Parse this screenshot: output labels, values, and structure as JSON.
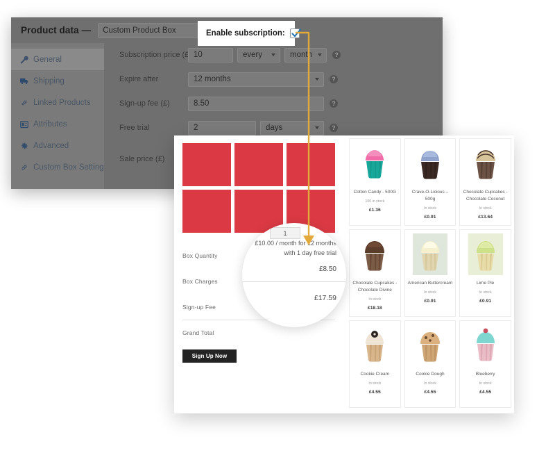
{
  "admin": {
    "title": "Product data —",
    "product_type": "Custom Product Box",
    "tabs": [
      {
        "label": "General",
        "icon": "wrench-icon"
      },
      {
        "label": "Shipping",
        "icon": "truck-icon"
      },
      {
        "label": "Linked Products",
        "icon": "link-icon"
      },
      {
        "label": "Attributes",
        "icon": "list-icon"
      },
      {
        "label": "Advanced",
        "icon": "gear-icon"
      },
      {
        "label": "Custom Box Settings",
        "icon": "link-icon"
      }
    ],
    "fields": [
      {
        "label": "Subscription price (£)",
        "value": "10",
        "every": "every",
        "period": "month"
      },
      {
        "label": "Expire after",
        "value": "12 months"
      },
      {
        "label": "Sign-up fee (£)",
        "value": "8.50"
      },
      {
        "label": "Free trial",
        "value": "2",
        "unit": "days"
      },
      {
        "label": "Sale price (£)",
        "value": ""
      }
    ]
  },
  "callout": {
    "enable_subscription_label": "Enable subscription:",
    "checked": true,
    "accent_color": "#e2a93b",
    "checkbox_color": "#2271b1"
  },
  "front": {
    "box_slot_color": "#db3a44",
    "box_slots": 6,
    "quantity": "1",
    "summary": [
      {
        "label": "Box Quantity",
        "value": "1"
      },
      {
        "label": "Box Charges",
        "value": "£10.00 / month for 12 months with 1 day free trial"
      },
      {
        "label": "Sign-up Fee",
        "value": "£8.50"
      },
      {
        "label": "Grand Total",
        "value": "£17.59"
      }
    ],
    "signup_button": "Sign Up Now"
  },
  "magnifier": {
    "quantity": "1",
    "charges_text": "£10.00 / month for 12 months with 1 day free trial",
    "signup_fee": "£8.50",
    "grand_total": "£17.59"
  },
  "products": [
    {
      "name": "Cotton Candy - 500G",
      "stock": "100 in stock",
      "price": "£1.36",
      "frosting": "#f06ba8",
      "liner": "#19a79a",
      "cake": "#19a79a"
    },
    {
      "name": "Crave-O-Licious – 500g",
      "stock": "In stock",
      "price": "£0.91",
      "frosting": "#8fa3cd",
      "liner": "#3b2a23",
      "cake": "#3b2a23"
    },
    {
      "name": "Chocolate Cupcakes - Chocolate Coconut",
      "stock": "In stock",
      "price": "£13.64",
      "frosting": "#d8c49a",
      "liner": "#4a362c",
      "cake": "#4a362c"
    },
    {
      "name": "Chocolate Cupcakes - Chocolate Divine",
      "stock": "In stock",
      "price": "£18.18",
      "frosting": "#5b3b2a",
      "liner": "#5b3b2a",
      "cake": "#5b3b2a"
    },
    {
      "name": "American Buttercream",
      "stock": "In stock",
      "price": "£0.91",
      "frosting": "#f2eac4",
      "liner": "#d9cfa8",
      "cake": "#cfd8c0"
    },
    {
      "name": "Lime Pie",
      "stock": "In stock",
      "price": "£0.91",
      "frosting": "#cfe08a",
      "liner": "#e3d8a6",
      "cake": "#b7cf7a"
    },
    {
      "name": "Cookie Cream",
      "stock": "In stock",
      "price": "£4.55",
      "frosting": "#efe3d4",
      "liner": "#cfa97e",
      "cake": "#2b2420"
    },
    {
      "name": "Cookie Dough",
      "stock": "In stock",
      "price": "£4.55",
      "frosting": "#d9b07e",
      "liner": "#c49a6c",
      "cake": "#b8895a"
    },
    {
      "name": "Blueberry",
      "stock": "In stock",
      "price": "£4.55",
      "frosting": "#7fd6d0",
      "liner": "#e4b7c2",
      "cake": "#c94f63"
    }
  ]
}
